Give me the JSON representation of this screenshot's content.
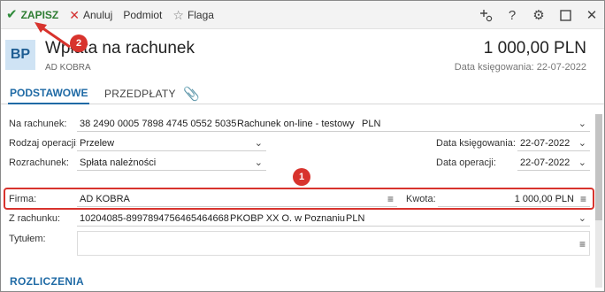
{
  "toolbar": {
    "save_label": "ZAPISZ",
    "cancel_label": "Anuluj",
    "subject_label": "Podmiot",
    "flag_label": "Flaga"
  },
  "header": {
    "badge": "BP",
    "title": "Wpłata na rachunek",
    "subtitle": "AD KOBRA",
    "amount": "1 000,00 PLN",
    "booking_date": "Data księgowania: 22-07-2022"
  },
  "tabs": {
    "basic": "PODSTAWOWE",
    "prepayments": "PRZEDPŁATY"
  },
  "form": {
    "account_label": "Na rachunek:",
    "account_number": "38 2490 0005 7898 4745 0552 5035",
    "account_name": "Rachunek on-line - testowy",
    "account_currency": "PLN",
    "operation_type_label": "Rodzaj operacji:",
    "operation_type": "Przelew",
    "settlement_label": "Rozrachunek:",
    "settlement": "Spłata należności",
    "booking_date_label": "Data księgowania:",
    "booking_date": "22-07-2022",
    "operation_date_label": "Data operacji:",
    "operation_date": "22-07-2022",
    "company_label": "Firma:",
    "company": "AD KOBRA",
    "amount_label": "Kwota:",
    "amount": "1 000,00 PLN",
    "from_account_label": "Z rachunku:",
    "from_account_number": "10204085-8997894756465464668",
    "from_account_bank": "PKOBP XX O. w Poznaniu",
    "from_account_currency": "PLN",
    "title_label": "Tytułem:"
  },
  "annotations": {
    "marker1": "1",
    "marker2": "2"
  },
  "sections": {
    "settlements": "ROZLICZENIA"
  },
  "colors": {
    "accent": "#1f6aa5",
    "highlight": "#d8332d",
    "save_green": "#2e8b3a"
  }
}
